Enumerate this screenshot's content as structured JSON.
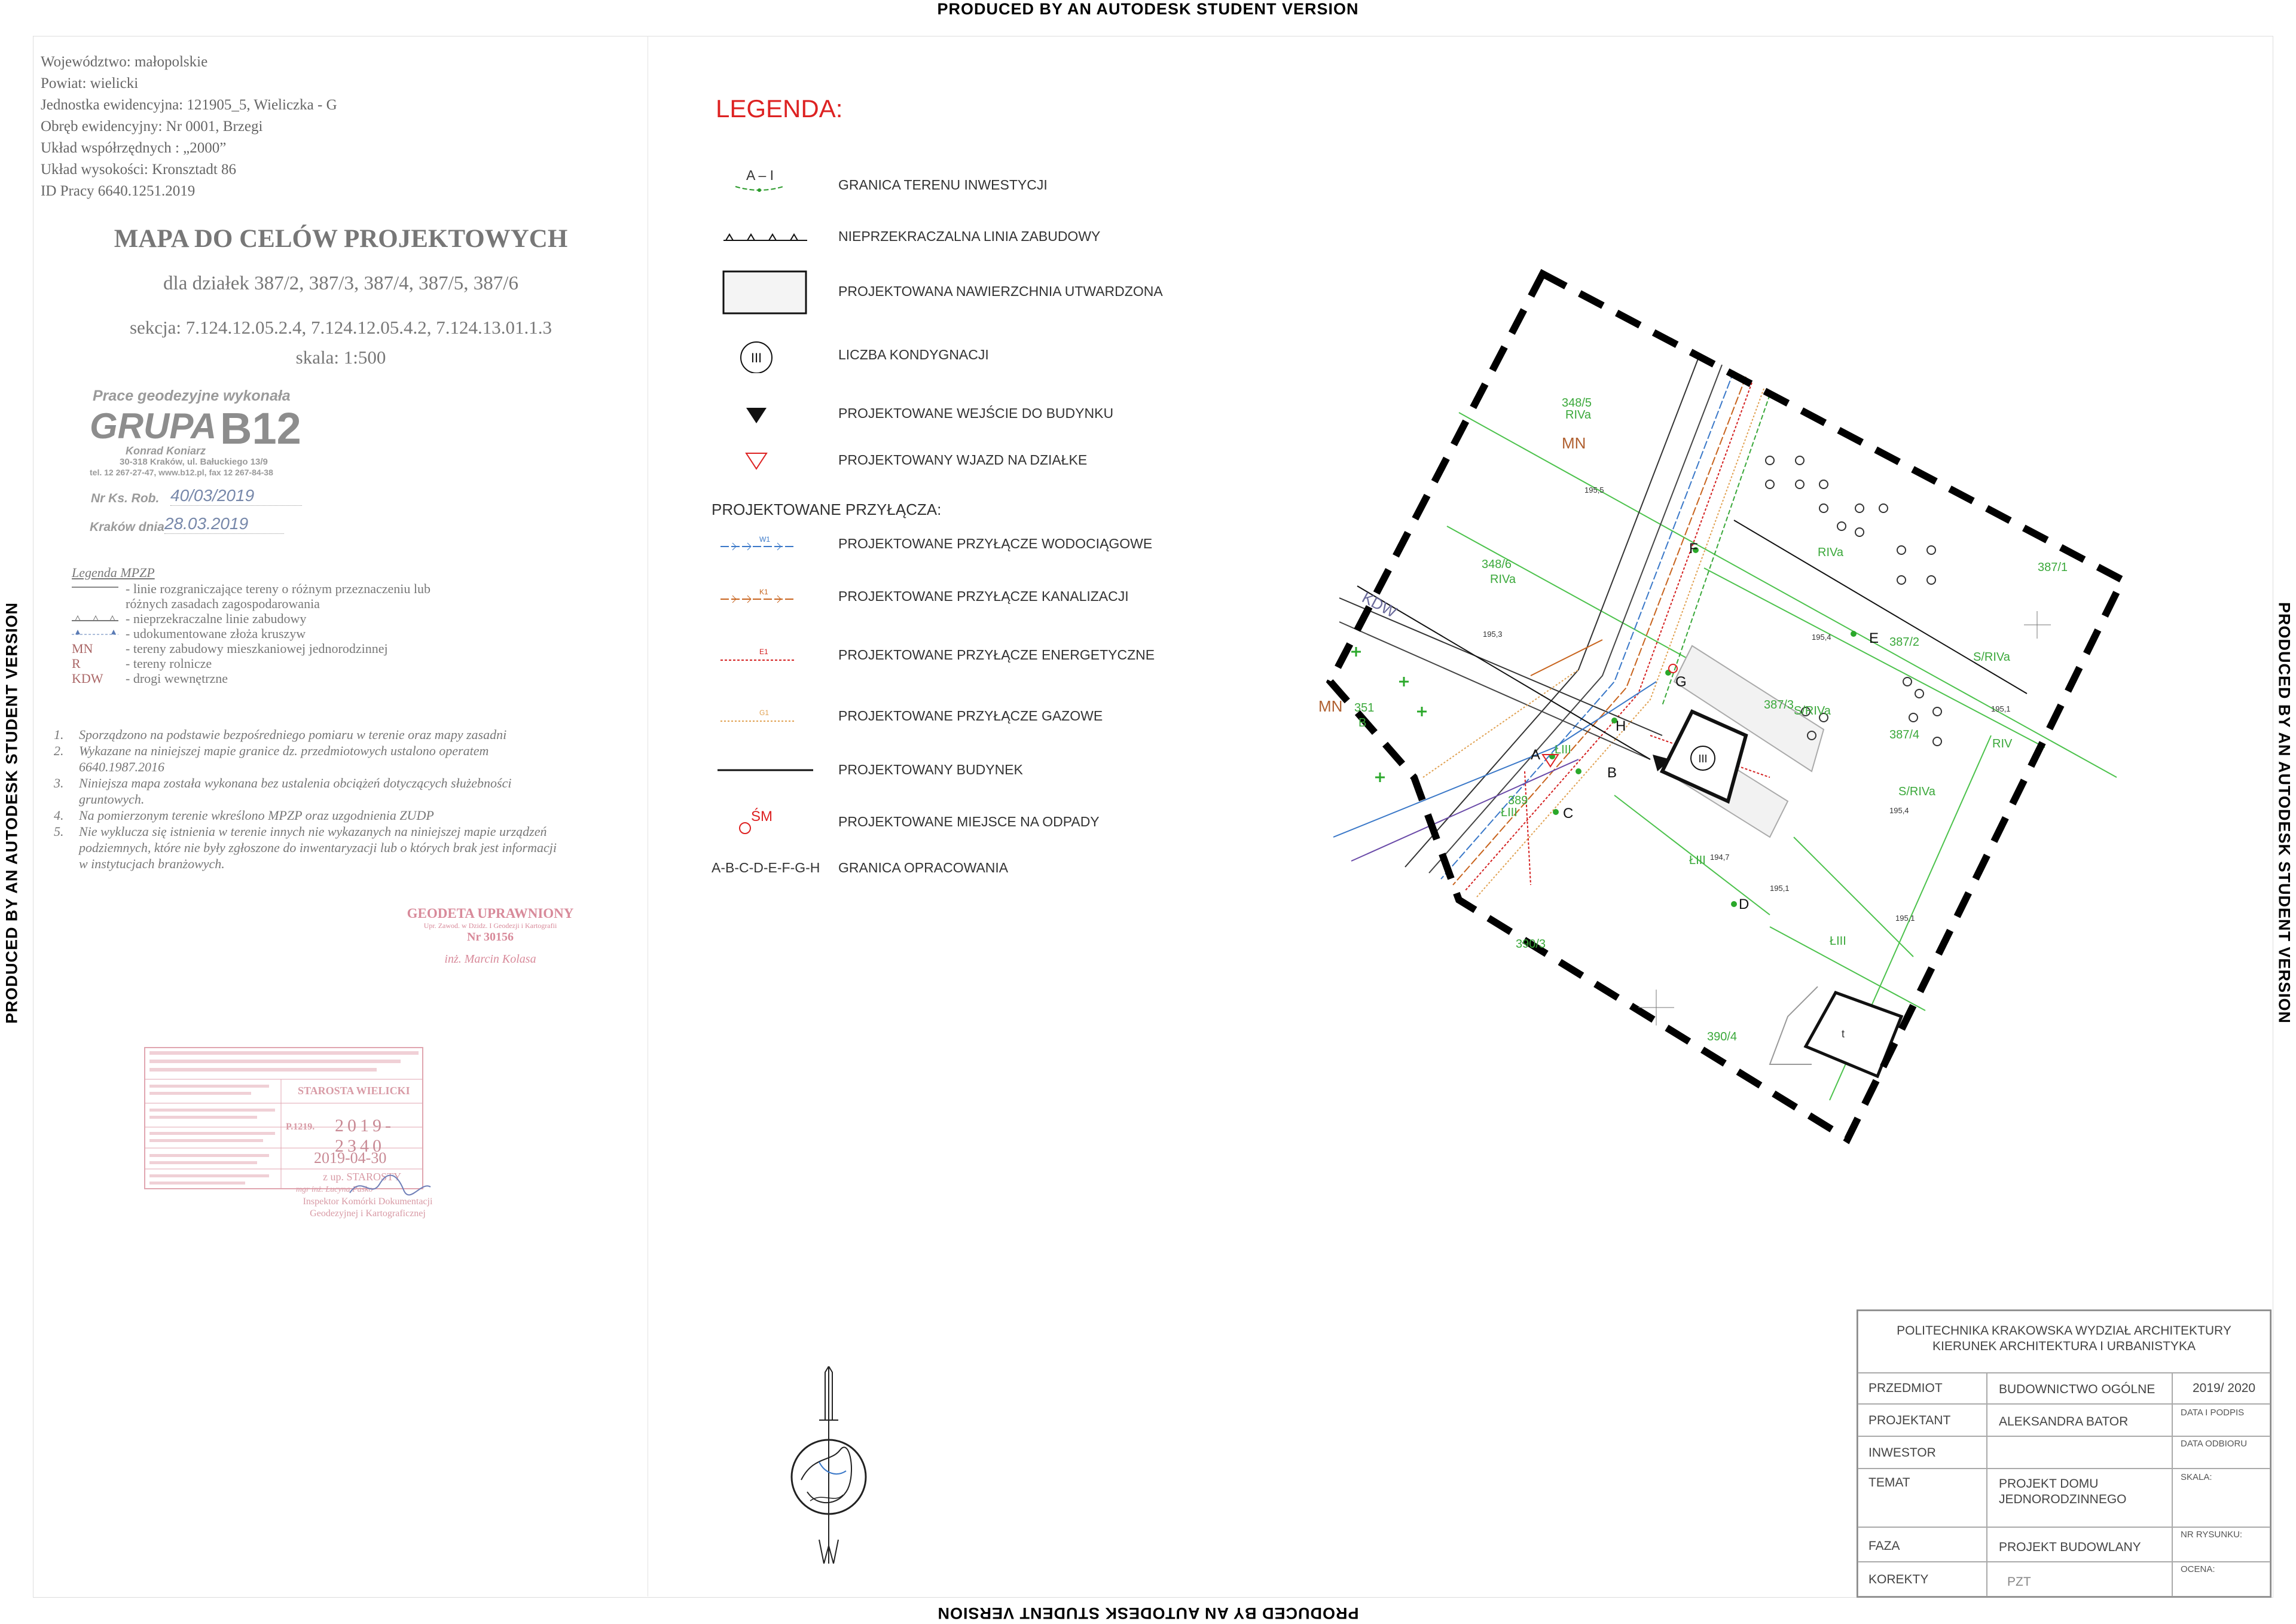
{
  "banners": {
    "watermark": "PRODUCED BY AN AUTODESK STUDENT VERSION"
  },
  "info": {
    "lines": [
      "Województwo: małopolskie",
      "Powiat: wielicki",
      "Jednostka ewidencyjna: 121905_5, Wieliczka - G",
      "Obręb ewidencyjny: Nr 0001, Brzegi",
      "Układ współrzędnych : „2000”",
      "Układ wysokości: Kronsztadt 86",
      "ID Pracy 6640.1251.2019"
    ]
  },
  "map_title": {
    "title": "MAPA DO CELÓW PROJEKTOWYCH",
    "subtitle": "dla działek 387/2, 387/3, 387/4, 387/5, 387/6",
    "section": "sekcja: 7.124.12.05.2.4, 7.124.12.05.4.2, 7.124.13.01.1.3",
    "scale": "skala: 1:500"
  },
  "company_stamp": {
    "heading": "Prace geodezyjne wykonała",
    "brand": "GRUPA",
    "brand_num": "B12",
    "owner": "Konrad Koniarz",
    "address": "30-318 Kraków, ul. Bałuckiego 13/9",
    "contact": "tel. 12 267-27-47, www.b12.pl, fax 12 267-84-38",
    "nr_label": "Nr Ks. Rob.",
    "nr_value": "40/03/2019",
    "date_label": "Kraków dnia",
    "date_value": "28.03.2019"
  },
  "mpzp_legend": {
    "title": "Legenda MPZP",
    "rows": [
      {
        "sym": "",
        "text": "- linie rozgraniczające tereny o różnym przeznaczeniu lub"
      },
      {
        "sym": "",
        "text": "różnych zasadach zagospodarowania"
      },
      {
        "sym": "",
        "text": "- nieprzekraczalne linie zabudowy"
      },
      {
        "sym": "",
        "text": "- udokumentowane złoża kruszyw"
      },
      {
        "sym": "MN",
        "text": "- tereny zabudowy mieszkaniowej jednorodzinnej"
      },
      {
        "sym": "R",
        "text": "- tereny rolnicze"
      },
      {
        "sym": "KDW",
        "text": "- drogi wewnętrzne"
      }
    ]
  },
  "notes": [
    {
      "num": "1.",
      "text": "Sporządzono na podstawie bezpośredniego pomiaru w terenie oraz mapy zasadni"
    },
    {
      "num": "2.",
      "text": "Wykazane na niniejszej mapie granice dz. przedmiotowych ustalono operatem 6640.1987.2016"
    },
    {
      "num": "3.",
      "text": "Niniejsza mapa została wykonana bez ustalenia obciążeń dotyczących służebności gruntowych."
    },
    {
      "num": "4.",
      "text": "Na pomierzonym terenie wkreślono MPZP oraz uzgodnienia ZUDP"
    },
    {
      "num": "5.",
      "text": "Nie wyklucza się istnienia w terenie innych nie wykazanych na niniejszej mapie urządzeń podziemnych, które nie były zgłoszone do inwentaryzacji lub o których brak jest informacji w instytucjach branżowych."
    }
  ],
  "surveyor_stamp": {
    "line1": "GEODETA UPRAWNIONY",
    "line2": "Upr. Zawod. w Dzidz. I Geodezji i Kartografii",
    "line3": "Nr 30156",
    "signature": "inż. Marcin Kolasa"
  },
  "office_stamp": {
    "office": "STAROSTA WIELICKI",
    "reg_label": "P.1219.",
    "reg_value": "2019-2340",
    "date": "2019-04-30",
    "sign": "z up. STAROSTY",
    "signer1": "mgr inż. Lucyna Pasko",
    "signer2": "Inspektor Komórki Dokumentacji",
    "signer3": "Geodezyjnej i Kartograficznej"
  },
  "legend": {
    "title": "LEGENDA:",
    "items": [
      {
        "label": "GRANICA TERENU INWESTYCJI",
        "sym_text": "A – I"
      },
      {
        "label": "NIEPRZEKRACZALNA LINIA ZABUDOWY"
      },
      {
        "label": "PROJEKTOWANA NAWIERZCHNIA UTWARDZONA"
      },
      {
        "label": "LICZBA KONDYGNACJI",
        "sym_text": "III"
      },
      {
        "label": "PROJEKTOWANE WEJŚCIE DO BUDYNKU"
      },
      {
        "label": "PROJEKTOWANY WJAZD NA DZIAŁKE"
      }
    ],
    "przylacza_title": "PROJEKTOWANE PRZYŁĄCZA:",
    "przylacza": [
      {
        "label": "PROJEKTOWANE PRZYŁĄCZE WODOCIĄGOWE",
        "color": "#3a78c8",
        "code": "W1"
      },
      {
        "label": "PROJEKTOWANE PRZYŁĄCZE KANALIZACJI",
        "color": "#c8641e",
        "code": "K1"
      },
      {
        "label": "PROJEKTOWANE PRZYŁĄCZE ENERGETYCZNE",
        "color": "#d42020",
        "code": "E1"
      },
      {
        "label": "PROJEKTOWANE PRZYŁĄCZE GAZOWE",
        "color": "#e0a050",
        "code": "G1"
      },
      {
        "label": "PROJEKTOWANY BUDYNEK"
      },
      {
        "label": "PROJEKTOWANE MIEJSCE NA ODPADY",
        "sym_text": "ŚM"
      },
      {
        "label": "GRANICA OPRACOWANIA",
        "sym_text": "A-B-C-D-E-F-G-H"
      }
    ]
  },
  "map": {
    "parcels": [
      "348/5",
      "348/6",
      "351",
      "387/1",
      "387/2",
      "387/3",
      "387/4",
      "389",
      "390/3",
      "390/4"
    ],
    "zones": [
      "MN",
      "MN",
      "KDW",
      "B",
      "RIVa",
      "RIVa",
      "RIVa",
      "S/RIVa",
      "S/RIVa",
      "S/RIVa",
      "ŁIII",
      "ŁIII",
      "ŁIII",
      "ŁIII",
      "RIV"
    ],
    "points": [
      "A",
      "B",
      "C",
      "D",
      "E",
      "F",
      "G",
      "H"
    ],
    "heights": [
      "195,5",
      "195,3",
      "195,4",
      "195,4",
      "195,1",
      "195,1",
      "194,7",
      "195,1"
    ],
    "building_floors": "III",
    "small_building": "t"
  },
  "title_block": {
    "school_line1": "POLITECHNIKA KRAKOWSKA WYDZIAŁ ARCHITEKTURY",
    "school_line2": "KIERUNEK ARCHITEKTURA I URBANISTYKA",
    "przedmiot_label": "PRZEDMIOT",
    "przedmiot_value": "BUDOWNICTWO OGÓLNE",
    "year": "2019/ 2020",
    "projektant_label": "PROJEKTANT",
    "projektant_value": "ALEKSANDRA BATOR",
    "data_podpis": "DATA I PODPIS",
    "inwestor_label": "INWESTOR",
    "data_odbioru": "DATA ODBIORU",
    "temat_label": "TEMAT",
    "temat_value1": "PROJEKT DOMU",
    "temat_value2": "JEDNORODZINNEGO",
    "skala_label": "SKALA:",
    "faza_label": "FAZA",
    "faza_value": "PROJEKT BUDOWLANY",
    "nr_rysunku": "NR RYSUNKU:",
    "korekty_label": "KOREKTY",
    "korekty_value": "PZT",
    "ocena": "OCENA:"
  }
}
